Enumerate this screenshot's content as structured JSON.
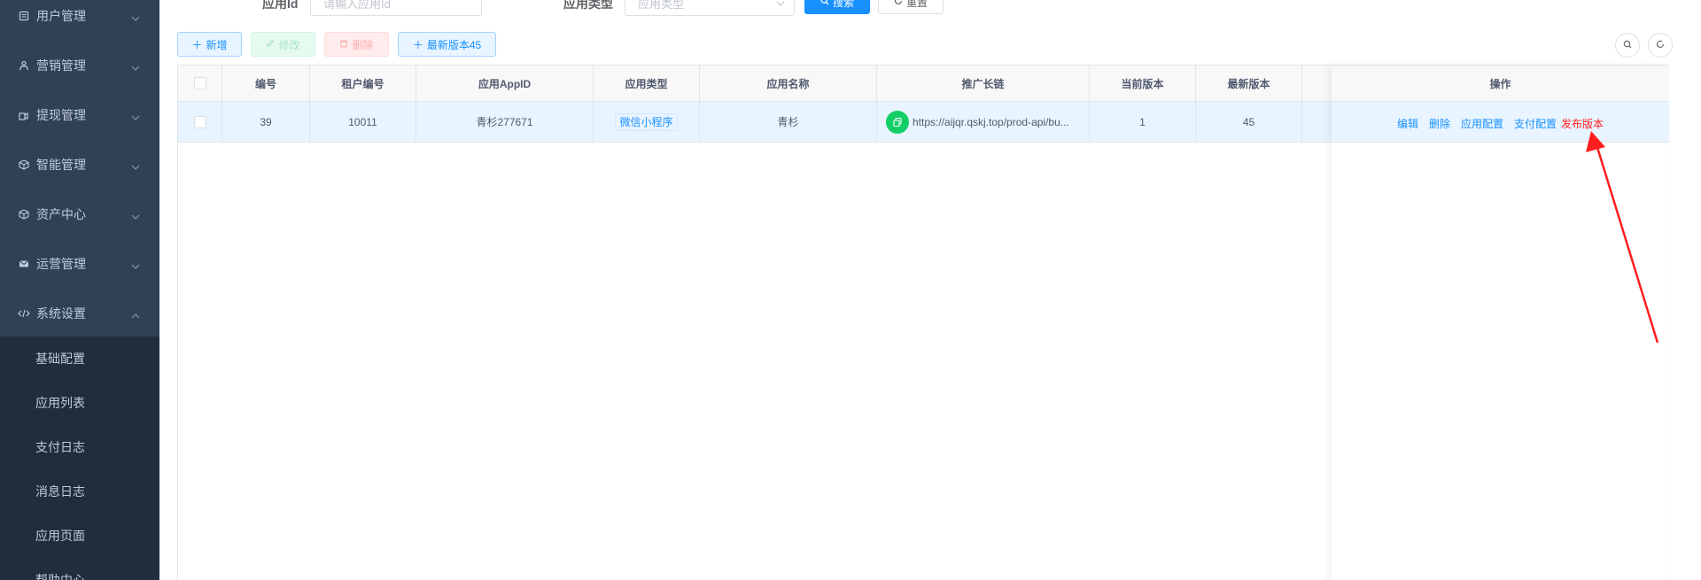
{
  "sidebar": {
    "menus": [
      {
        "label": "用户管理",
        "icon": "user-icon"
      },
      {
        "label": "营销管理",
        "icon": "people-icon"
      },
      {
        "label": "提现管理",
        "icon": "withdraw-icon"
      },
      {
        "label": "智能管理",
        "icon": "cube-icon"
      },
      {
        "label": "资产中心",
        "icon": "cube-icon"
      },
      {
        "label": "运营管理",
        "icon": "mail-icon"
      },
      {
        "label": "系统设置",
        "icon": "code-icon"
      }
    ],
    "submenu": [
      {
        "label": "基础配置"
      },
      {
        "label": "应用列表"
      },
      {
        "label": "支付日志"
      },
      {
        "label": "消息日志"
      },
      {
        "label": "应用页面"
      },
      {
        "label": "帮助中心"
      }
    ]
  },
  "search": {
    "app_id_label": "应用Id",
    "app_id_placeholder": "请输入应用Id",
    "app_type_label": "应用类型",
    "app_type_placeholder": "应用类型",
    "search_button": "搜索",
    "reset_button": "重置"
  },
  "toolbar": {
    "add_label": "新增",
    "edit_label": "修改",
    "delete_label": "删除",
    "latest_version_label": "最新版本45"
  },
  "table": {
    "columns": [
      "编号",
      "租户编号",
      "应用AppID",
      "应用类型",
      "应用名称",
      "推广长链",
      "当前版本",
      "最新版本"
    ],
    "actions_header": "操作",
    "rows": [
      {
        "id": "39",
        "tenant_id": "10011",
        "app_id": "青杉277671",
        "app_type": "微信小程序",
        "app_name": "青杉",
        "promo_link": "https://aijqr.qskj.top/prod-api/bu...",
        "current_version": "1",
        "latest_version": "45",
        "actions": [
          "编辑",
          "删除",
          "应用配置",
          "支付配置",
          "发布版本"
        ]
      }
    ]
  },
  "colors": {
    "sidebar_bg": "#304156",
    "primary": "#1890ff",
    "danger": "#ff1e1e",
    "success": "#13ce66"
  }
}
